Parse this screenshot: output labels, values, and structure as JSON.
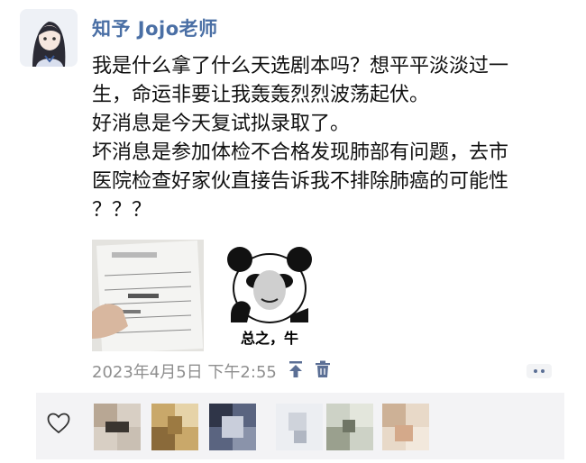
{
  "post": {
    "author": "知予 Jojo老师",
    "text_lines": [
      "我是什么拿了什么天选剧本吗？想平平淡淡过一",
      "生，命运非要让我轰轰烈烈波荡起伏。",
      "好消息是今天复试拟录取了。",
      "坏消息是参加体检不合格发现肺部有问题，去市",
      "医院检查好家伙直接告诉我不排除肺癌的可能性",
      "？？？"
    ],
    "meme_caption": "总之，牛",
    "timestamp": "2023年4月5日 下午2:55"
  },
  "icons": {
    "pin": "pin-top-icon",
    "delete": "trash-icon",
    "more": "more-dots-icon",
    "like": "heart-icon"
  },
  "colors": {
    "author": "#4a6fa5",
    "timestamp": "#8f8f8f",
    "icon_blue": "#5b6f95",
    "likes_bg": "#f3f3f5"
  }
}
